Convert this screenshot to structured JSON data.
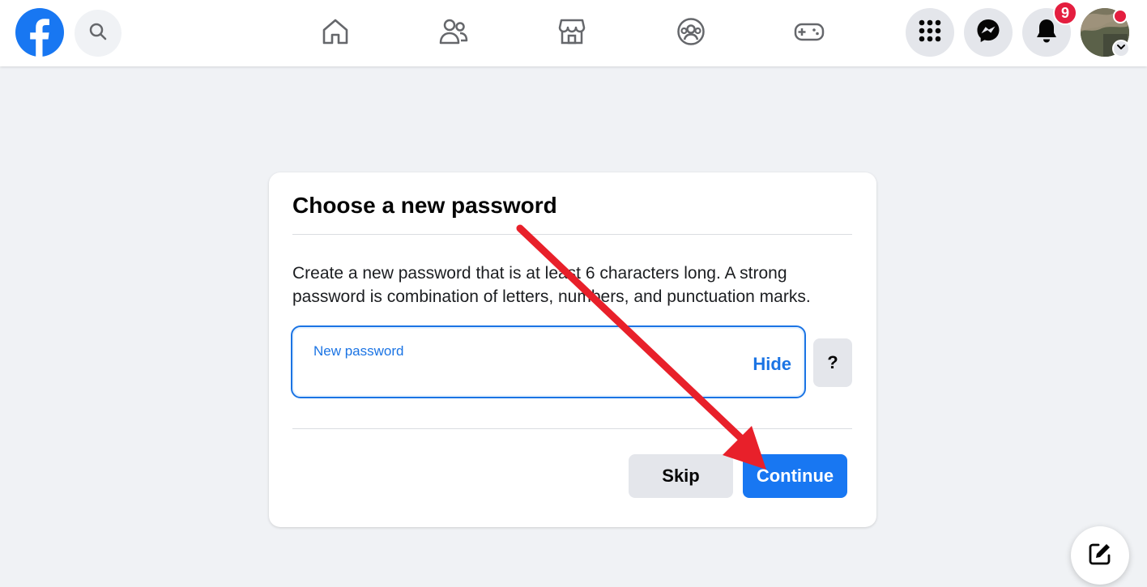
{
  "app": {
    "brand_color": "#1877f2",
    "logo_icon": "facebook-logo-icon"
  },
  "header": {
    "search_icon": "search-icon",
    "nav_items": [
      {
        "name": "home",
        "icon": "home-icon"
      },
      {
        "name": "friends",
        "icon": "friends-icon"
      },
      {
        "name": "marketplace",
        "icon": "marketplace-icon"
      },
      {
        "name": "groups",
        "icon": "groups-icon"
      },
      {
        "name": "gaming",
        "icon": "gaming-icon"
      }
    ],
    "right_buttons": [
      {
        "name": "menu",
        "icon": "grid-menu-icon"
      },
      {
        "name": "messenger",
        "icon": "messenger-icon"
      },
      {
        "name": "notifications",
        "icon": "bell-icon"
      }
    ],
    "notification_count": "9",
    "notification_badge_color": "#e41e3f"
  },
  "card": {
    "title": "Choose a new password",
    "description": "Create a new password that is at least 6 characters long. A strong password is combination of letters, numbers, and punctuation marks.",
    "password_field": {
      "label": "New password",
      "value": "",
      "toggle_label": "Hide"
    },
    "help_label": "?",
    "skip_label": "Skip",
    "continue_label": "Continue"
  },
  "annotation": {
    "arrow_color": "#e8202a",
    "points_to": "continue-button"
  },
  "floating": {
    "compose_icon": "compose-icon"
  }
}
